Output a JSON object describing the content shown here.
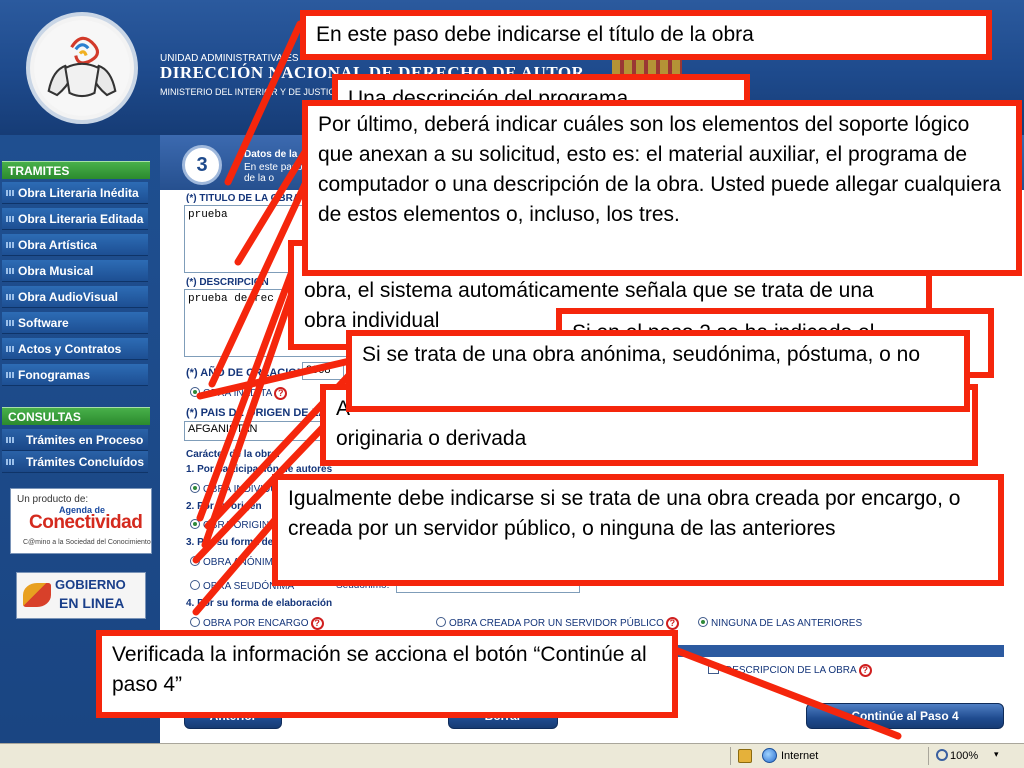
{
  "header": {
    "unit": "UNIDAD ADMINISTRATIVA ES",
    "title": "DIRECCIÓN NACIONAL DE DERECHO DE AUTOR",
    "ministry": "MINISTERIO DEL INTERIOR Y DE JUSTICIA"
  },
  "sidebar": {
    "tramites_heading": "TRAMITES",
    "tramites": [
      "Obra Literaria Inédita",
      "Obra Literaria Editada",
      "Obra Artística",
      "Obra Musical",
      "Obra AudioVisual",
      "Software",
      "Actos y Contratos",
      "Fonogramas"
    ],
    "consultas_heading": "CONSULTAS",
    "consultas": [
      "Trámites en Proceso",
      "Trámites Concluídos"
    ],
    "promo1": {
      "small": "Un producto de:",
      "agenda": "Agenda de",
      "brand": "Conectividad",
      "tagline": "C@mino a la Sociedad del Conocimiento"
    },
    "promo2": {
      "line1": "GOBIERNO",
      "line2": "EN LINEA"
    }
  },
  "form": {
    "step_number": "3",
    "step_title": "Datos de la",
    "step_line1": "En este paso",
    "step_line2": "de la o",
    "title_label": "(*) TITULO DE LA OBRA",
    "title_value": "prueba",
    "desc_label": "(*) DESCRIPCION",
    "desc_value": "prueba de rec",
    "year_label": "(*) AÑO DE CREACION",
    "year_value": "2008",
    "inedita_label": "OBRA INÉDITA",
    "country_label": "(*) PAIS DE ORIGEN DE LA",
    "country_value": "AFGANISTAN",
    "caracter_label": "Carácter de la obra:",
    "sec1": "1. Por participación de autores",
    "sec1_opt": "OBRA INDIVIDUAL",
    "sec2": "2. Por su origen",
    "sec2_opt": "OBRA ORIGINARIA",
    "sec3": "3. Por su forma de publicación",
    "sec3_opt1": "OBRA ANÓNIMA",
    "sec3_opt2": "OBRA SEUDÓNIMA",
    "seudonimo_label": "Seudónimo:",
    "sec4": "4. Por su forma de elaboración",
    "sec4_opt1": "OBRA POR ENCARGO",
    "sec4_opt2": "OBRA CREADA POR UN SERVIDOR PÚBLICO",
    "sec4_opt3": "NINGUNA DE LAS ANTERIORES",
    "desc_check": "DESCRIPCION DE LA OBRA",
    "btn_prev": "Anterior",
    "btn_clear": "Borrar",
    "btn_next": "Continúe al Paso 4"
  },
  "annotations": {
    "a1": "En este paso debe indicarse el título de la obra",
    "a2": "Una descripción del programa",
    "a3": "Por último, deberá indicar cuáles son los elementos del soporte lógico que anexan a su solicitud, esto es: el material auxiliar, el programa de computador o una descripción de la obra. Usted puede allegar cualquiera de estos elementos o, incluso, los tres.",
    "a4": "obra, el sistema automáticamente señala que se trata de una obra individual",
    "a5": "Si en el paso 2 se ha indicado el",
    "a6": "Si se trata de una obra anónima, seudónima, póstuma, o no",
    "a7": "A",
    "a7b": "originaria o derivada",
    "a8": "Igualmente debe indicarse si se trata de una obra creada por encargo, o creada por un servidor público, o ninguna de las anteriores",
    "a9": "Verificada la información se acciona el botón “Continúe al paso 4”"
  },
  "statusbar": {
    "zone": "Internet",
    "zoom": "100%"
  },
  "colors": {
    "annotation_border": "#f5260c",
    "header_blue": "#1e4a8c",
    "menu_green": "#2b8a2e"
  }
}
